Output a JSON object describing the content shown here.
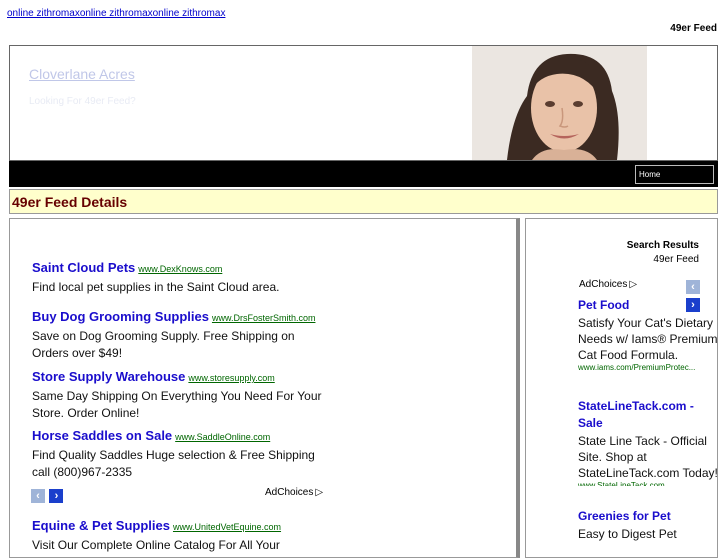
{
  "top_links": "online zithromaxonline zithromaxonline zithromax",
  "top_right": "49er Feed",
  "header": {
    "title": "Cloverlane Acres",
    "tagline": "Looking For 49er Feed?"
  },
  "nav": {
    "home": "Home"
  },
  "section_title": "49er Feed Details",
  "main_ads": [
    {
      "title": "Saint Cloud Pets",
      "url": "www.DexKnows.com",
      "desc": "Find local pet supplies in the Saint Cloud area."
    },
    {
      "title": "Buy Dog Grooming Supplies",
      "url": "www.DrsFosterSmith.com",
      "desc": "Save on Dog Grooming Supply. Free Shipping on Orders over $49!"
    },
    {
      "title": "Store Supply Warehouse",
      "url": "www.storesupply.com",
      "desc": "Same Day Shipping On Everything You Need For Your Store. Order Online!"
    },
    {
      "title": "Horse Saddles on Sale",
      "url": "www.SaddleOnline.com",
      "desc": "Find Quality Saddles Huge selection & Free Shipping call (800)967-2335"
    },
    {
      "title": "Equine & Pet Supplies",
      "url": "www.UnitedVetEquine.com",
      "desc": "Visit Our Complete Online Catalog For All Your"
    }
  ],
  "adchoices": "AdChoices",
  "side": {
    "heading": "Search Results",
    "sub": "49er Feed",
    "ads": [
      {
        "title": "Pet Food",
        "desc": "Satisfy Your Cat's Dietary Needs w/ Iams® Premium Cat Food Formula.",
        "url": "www.iams.com/PremiumProtec..."
      },
      {
        "title": "StateLineTack.com - Sale",
        "desc": "State Line Tack - Official Site. Shop at StateLineTack.com Today!",
        "url": "www.StateLineTack.com"
      },
      {
        "title": "Greenies for Pet",
        "desc": "Easy to Digest Pet",
        "url": ""
      }
    ]
  },
  "colors": {
    "nav_bg": "#000000",
    "section_bg": "#ffffcc",
    "section_text": "#660000",
    "ad_title": "#1a0dcc",
    "ad_url": "#006600"
  }
}
